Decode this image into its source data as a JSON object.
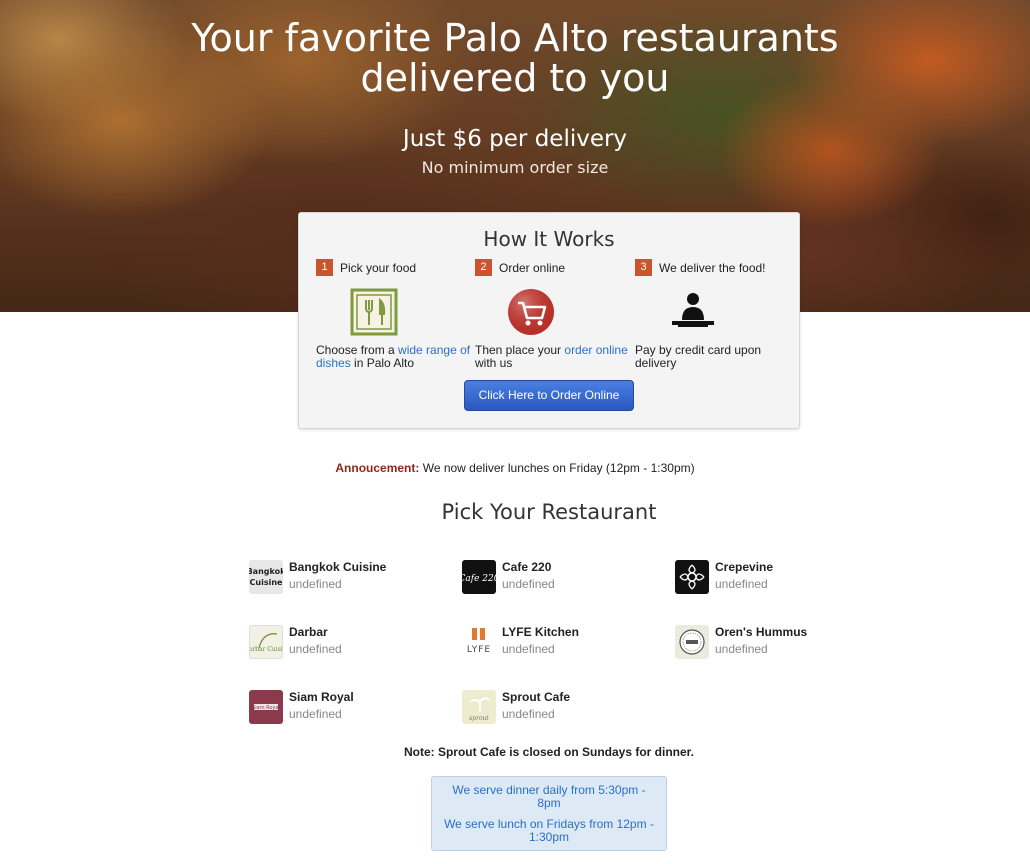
{
  "hero": {
    "title_line1": "Your favorite Palo Alto restaurants",
    "title_line2": "delivered to you",
    "price": "Just $6 per delivery",
    "subtitle": "No minimum order size"
  },
  "how_it_works": {
    "title": "How It Works",
    "steps": [
      {
        "num": "1",
        "label": "Pick your food",
        "text_pre": "Choose from a ",
        "link": "wide range of dishes",
        "text_post": " in Palo Alto",
        "icon": "fork-knife-icon"
      },
      {
        "num": "2",
        "label": "Order online",
        "text_pre": "Then place your ",
        "link": "order online",
        "text_post": " with us",
        "icon": "shopping-cart-icon"
      },
      {
        "num": "3",
        "label": "We deliver the food!",
        "text_pre": "Pay by credit card upon delivery",
        "link": "",
        "text_post": "",
        "icon": "delivery-person-icon"
      }
    ],
    "order_button": "Click Here to Order Online"
  },
  "announcement": {
    "label": "Annoucement:",
    "text": " We now deliver lunches on Friday (12pm - 1:30pm)"
  },
  "pick_title": "Pick Your Restaurant",
  "restaurants": [
    {
      "name": "Bangkok Cuisine",
      "sub": "undefined",
      "logo_text": "Bangkok Cuisine"
    },
    {
      "name": "Cafe 220",
      "sub": "undefined",
      "logo_text": "Cafe 220"
    },
    {
      "name": "Crepevine",
      "sub": "undefined",
      "logo_text": ""
    },
    {
      "name": "Darbar",
      "sub": "undefined",
      "logo_text": "Darbar Cuisine"
    },
    {
      "name": "LYFE Kitchen",
      "sub": "undefined",
      "logo_text": "LYFE"
    },
    {
      "name": "Oren's Hummus",
      "sub": "undefined",
      "logo_text": ""
    },
    {
      "name": "Siam Royal",
      "sub": "undefined",
      "logo_text": "Siam Royal"
    },
    {
      "name": "Sprout Cafe",
      "sub": "undefined",
      "logo_text": "sprout"
    }
  ],
  "note": "Note: Sprout Cafe is closed on Sundays for dinner.",
  "hours": {
    "dinner": "We serve dinner daily from 5:30pm - 8pm",
    "lunch": "We serve lunch on Fridays from 12pm - 1:30pm"
  },
  "colors": {
    "step_badge": "#c8562a",
    "link": "#2a6fc9",
    "button": "#2b58c2",
    "announce_label": "#8b2a1c",
    "hours_bg": "#dde9f5"
  }
}
